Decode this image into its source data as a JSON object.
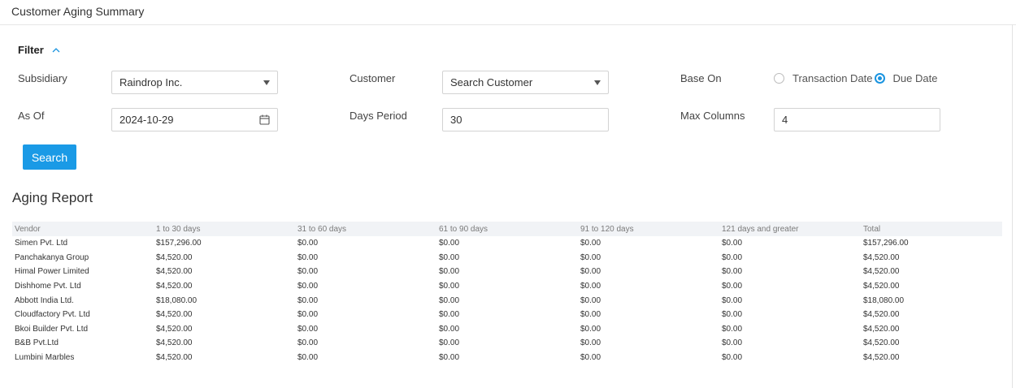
{
  "page": {
    "title": "Customer Aging Summary"
  },
  "filter": {
    "label": "Filter",
    "subsidiary": {
      "label": "Subsidiary",
      "value": "Raindrop Inc."
    },
    "customer": {
      "label": "Customer",
      "placeholder": "Search Customer"
    },
    "base_on": {
      "label": "Base On",
      "options": [
        {
          "label": "Transaction Date",
          "checked": false
        },
        {
          "label": "Due Date",
          "checked": true
        }
      ]
    },
    "as_of": {
      "label": "As Of",
      "value": "2024-10-29"
    },
    "days_period": {
      "label": "Days Period",
      "value": "30"
    },
    "max_columns": {
      "label": "Max Columns",
      "value": "4"
    },
    "search_label": "Search"
  },
  "report": {
    "title": "Aging Report",
    "columns": [
      "Vendor",
      "1 to 30 days",
      "31 to 60 days",
      "61 to 90 days",
      "91 to 120 days",
      "121 days and greater",
      "Total"
    ],
    "rows": [
      [
        "Simen Pvt. Ltd",
        "$157,296.00",
        "$0.00",
        "$0.00",
        "$0.00",
        "$0.00",
        "$157,296.00"
      ],
      [
        "Panchakanya Group",
        "$4,520.00",
        "$0.00",
        "$0.00",
        "$0.00",
        "$0.00",
        "$4,520.00"
      ],
      [
        "Himal Power Limited",
        "$4,520.00",
        "$0.00",
        "$0.00",
        "$0.00",
        "$0.00",
        "$4,520.00"
      ],
      [
        "Dishhome Pvt. Ltd",
        "$4,520.00",
        "$0.00",
        "$0.00",
        "$0.00",
        "$0.00",
        "$4,520.00"
      ],
      [
        "Abbott India Ltd.",
        "$18,080.00",
        "$0.00",
        "$0.00",
        "$0.00",
        "$0.00",
        "$18,080.00"
      ],
      [
        "Cloudfactory Pvt. Ltd",
        "$4,520.00",
        "$0.00",
        "$0.00",
        "$0.00",
        "$0.00",
        "$4,520.00"
      ],
      [
        "Bkoi Builder Pvt. Ltd",
        "$4,520.00",
        "$0.00",
        "$0.00",
        "$0.00",
        "$0.00",
        "$4,520.00"
      ],
      [
        "B&B Pvt.Ltd",
        "$4,520.00",
        "$0.00",
        "$0.00",
        "$0.00",
        "$0.00",
        "$4,520.00"
      ],
      [
        "Lumbini Marbles",
        "$4,520.00",
        "$0.00",
        "$0.00",
        "$0.00",
        "$0.00",
        "$4,520.00"
      ]
    ]
  },
  "colors": {
    "accent": "#1a9ae6",
    "header_row": "#f1f3f6",
    "border": "#d3d3d3"
  },
  "icons": {
    "filter_toggle": "chevron-up-icon",
    "select_arrow": "caret-down-icon",
    "date_picker": "calendar-icon"
  }
}
